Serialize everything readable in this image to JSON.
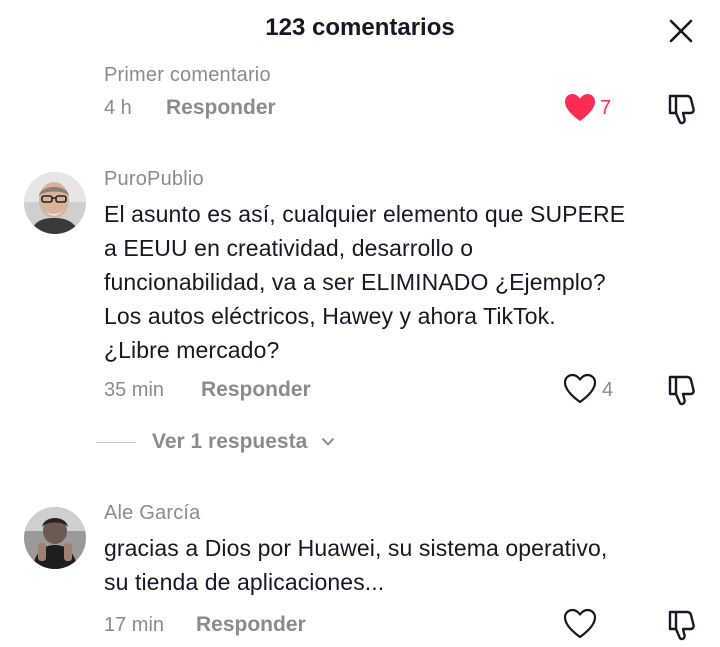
{
  "header": {
    "title": "123 comentarios",
    "close_icon": "close-icon"
  },
  "comments": [
    {
      "username": "Primer comentario",
      "text": "",
      "time": "4 h",
      "reply_label": "Responder",
      "likes": "7",
      "liked": true
    },
    {
      "username": "PuroPublio",
      "text": "El asunto es así, cualquier elemento que SUPERE\na EEUU en creatividad, desarrollo o\nfuncionabilidad, va a ser ELIMINADO ¿Ejemplo?\nLos autos eléctricos, Hawey y ahora TikTok.\n¿Libre mercado?",
      "time": "35 min",
      "reply_label": "Responder",
      "likes": "4",
      "liked": false,
      "view_replies": "Ver 1 respuesta"
    },
    {
      "username": "Ale García",
      "text": "gracias a Dios por Huawei, su sistema operativo,\nsu tienda de aplicaciones...",
      "time": "17 min",
      "reply_label": "Responder",
      "likes": "",
      "liked": false
    }
  ],
  "colors": {
    "accent_like": "#fe2c55",
    "muted": "#8a8b91",
    "text": "#161823"
  }
}
